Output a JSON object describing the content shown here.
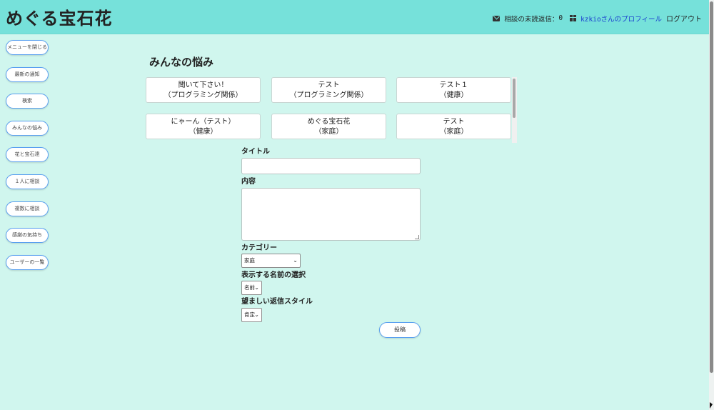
{
  "header": {
    "brand": "めぐる宝石花",
    "unread_label": "相談の未読返信：",
    "unread_count": "0",
    "profile_link": "kzkioさんのプロフィール",
    "logout_link": "ログアウト",
    "icons": [
      "mail-icon",
      "gift-icon"
    ]
  },
  "sidebar": {
    "items": [
      {
        "label": "メニューを閉じる"
      },
      {
        "label": "最新の通知"
      },
      {
        "label": "検索"
      },
      {
        "label": "みんなの悩み"
      },
      {
        "label": "花と宝石達"
      },
      {
        "label": "１人に相談"
      },
      {
        "label": "複数に相談"
      },
      {
        "label": "感謝の気持ち"
      },
      {
        "label": "ユーザーの一覧"
      }
    ]
  },
  "main": {
    "title": "みんなの悩み",
    "topics": [
      {
        "title": "聞いて下さい！",
        "category": "（プログラミング関係）"
      },
      {
        "title": "テスト",
        "category": "（プログラミング関係）"
      },
      {
        "title": "テスト１",
        "category": "（健康）"
      },
      {
        "title": "にゃーん（テスト）",
        "category": "（健康）"
      },
      {
        "title": "めぐる宝石花",
        "category": "（家庭）"
      },
      {
        "title": "テスト",
        "category": "（家庭）"
      }
    ]
  },
  "form": {
    "title_label": "タイトル",
    "title_value": "",
    "content_label": "内容",
    "content_value": "",
    "category_label": "カテゴリー",
    "category_selected": "家庭",
    "name_label": "表示する名前の選択",
    "name_selected": "名前",
    "style_label": "望ましい返信スタイル",
    "style_selected": "肯定",
    "submit_label": "投稿"
  },
  "colors": {
    "header_bg": "#76e1da",
    "page_bg": "#d0f6ee",
    "button_border": "#5aa0f0",
    "link": "#1a3fcf"
  }
}
